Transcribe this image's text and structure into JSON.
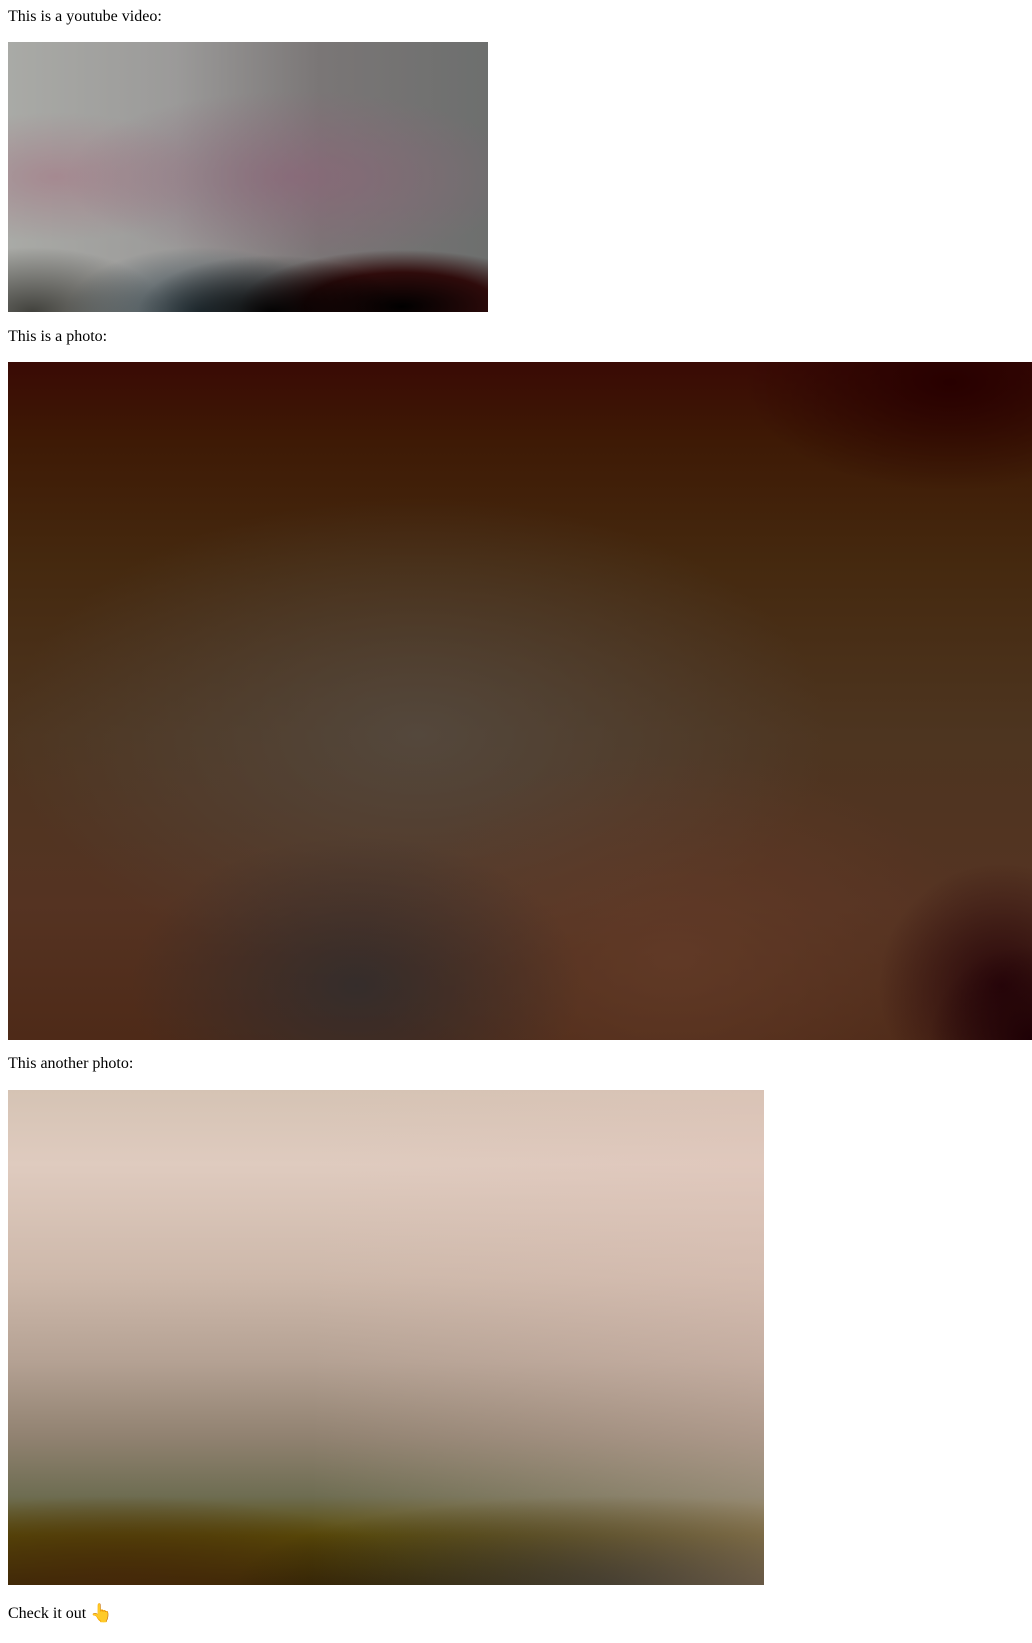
{
  "post": {
    "video_caption": "This is a youtube video:",
    "photo_caption": "This is a photo:",
    "another_photo_caption": "This another photo:",
    "cta_text": "Check it out",
    "cta_emoji": "👆"
  }
}
